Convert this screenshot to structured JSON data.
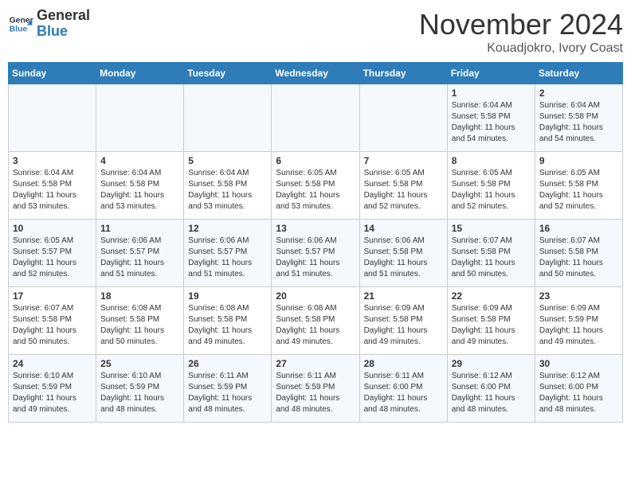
{
  "header": {
    "logo_general": "General",
    "logo_blue": "Blue",
    "month": "November 2024",
    "location": "Kouadjokro, Ivory Coast"
  },
  "weekdays": [
    "Sunday",
    "Monday",
    "Tuesday",
    "Wednesday",
    "Thursday",
    "Friday",
    "Saturday"
  ],
  "weeks": [
    [
      {
        "day": "",
        "content": ""
      },
      {
        "day": "",
        "content": ""
      },
      {
        "day": "",
        "content": ""
      },
      {
        "day": "",
        "content": ""
      },
      {
        "day": "",
        "content": ""
      },
      {
        "day": "1",
        "content": "Sunrise: 6:04 AM\nSunset: 5:58 PM\nDaylight: 11 hours and 54 minutes."
      },
      {
        "day": "2",
        "content": "Sunrise: 6:04 AM\nSunset: 5:58 PM\nDaylight: 11 hours and 54 minutes."
      }
    ],
    [
      {
        "day": "3",
        "content": "Sunrise: 6:04 AM\nSunset: 5:58 PM\nDaylight: 11 hours and 53 minutes."
      },
      {
        "day": "4",
        "content": "Sunrise: 6:04 AM\nSunset: 5:58 PM\nDaylight: 11 hours and 53 minutes."
      },
      {
        "day": "5",
        "content": "Sunrise: 6:04 AM\nSunset: 5:58 PM\nDaylight: 11 hours and 53 minutes."
      },
      {
        "day": "6",
        "content": "Sunrise: 6:05 AM\nSunset: 5:58 PM\nDaylight: 11 hours and 53 minutes."
      },
      {
        "day": "7",
        "content": "Sunrise: 6:05 AM\nSunset: 5:58 PM\nDaylight: 11 hours and 52 minutes."
      },
      {
        "day": "8",
        "content": "Sunrise: 6:05 AM\nSunset: 5:58 PM\nDaylight: 11 hours and 52 minutes."
      },
      {
        "day": "9",
        "content": "Sunrise: 6:05 AM\nSunset: 5:58 PM\nDaylight: 11 hours and 52 minutes."
      }
    ],
    [
      {
        "day": "10",
        "content": "Sunrise: 6:05 AM\nSunset: 5:57 PM\nDaylight: 11 hours and 52 minutes."
      },
      {
        "day": "11",
        "content": "Sunrise: 6:06 AM\nSunset: 5:57 PM\nDaylight: 11 hours and 51 minutes."
      },
      {
        "day": "12",
        "content": "Sunrise: 6:06 AM\nSunset: 5:57 PM\nDaylight: 11 hours and 51 minutes."
      },
      {
        "day": "13",
        "content": "Sunrise: 6:06 AM\nSunset: 5:57 PM\nDaylight: 11 hours and 51 minutes."
      },
      {
        "day": "14",
        "content": "Sunrise: 6:06 AM\nSunset: 5:58 PM\nDaylight: 11 hours and 51 minutes."
      },
      {
        "day": "15",
        "content": "Sunrise: 6:07 AM\nSunset: 5:58 PM\nDaylight: 11 hours and 50 minutes."
      },
      {
        "day": "16",
        "content": "Sunrise: 6:07 AM\nSunset: 5:58 PM\nDaylight: 11 hours and 50 minutes."
      }
    ],
    [
      {
        "day": "17",
        "content": "Sunrise: 6:07 AM\nSunset: 5:58 PM\nDaylight: 11 hours and 50 minutes."
      },
      {
        "day": "18",
        "content": "Sunrise: 6:08 AM\nSunset: 5:58 PM\nDaylight: 11 hours and 50 minutes."
      },
      {
        "day": "19",
        "content": "Sunrise: 6:08 AM\nSunset: 5:58 PM\nDaylight: 11 hours and 49 minutes."
      },
      {
        "day": "20",
        "content": "Sunrise: 6:08 AM\nSunset: 5:58 PM\nDaylight: 11 hours and 49 minutes."
      },
      {
        "day": "21",
        "content": "Sunrise: 6:09 AM\nSunset: 5:58 PM\nDaylight: 11 hours and 49 minutes."
      },
      {
        "day": "22",
        "content": "Sunrise: 6:09 AM\nSunset: 5:58 PM\nDaylight: 11 hours and 49 minutes."
      },
      {
        "day": "23",
        "content": "Sunrise: 6:09 AM\nSunset: 5:59 PM\nDaylight: 11 hours and 49 minutes."
      }
    ],
    [
      {
        "day": "24",
        "content": "Sunrise: 6:10 AM\nSunset: 5:59 PM\nDaylight: 11 hours and 49 minutes."
      },
      {
        "day": "25",
        "content": "Sunrise: 6:10 AM\nSunset: 5:59 PM\nDaylight: 11 hours and 48 minutes."
      },
      {
        "day": "26",
        "content": "Sunrise: 6:11 AM\nSunset: 5:59 PM\nDaylight: 11 hours and 48 minutes."
      },
      {
        "day": "27",
        "content": "Sunrise: 6:11 AM\nSunset: 5:59 PM\nDaylight: 11 hours and 48 minutes."
      },
      {
        "day": "28",
        "content": "Sunrise: 6:11 AM\nSunset: 6:00 PM\nDaylight: 11 hours and 48 minutes."
      },
      {
        "day": "29",
        "content": "Sunrise: 6:12 AM\nSunset: 6:00 PM\nDaylight: 11 hours and 48 minutes."
      },
      {
        "day": "30",
        "content": "Sunrise: 6:12 AM\nSunset: 6:00 PM\nDaylight: 11 hours and 48 minutes."
      }
    ]
  ]
}
